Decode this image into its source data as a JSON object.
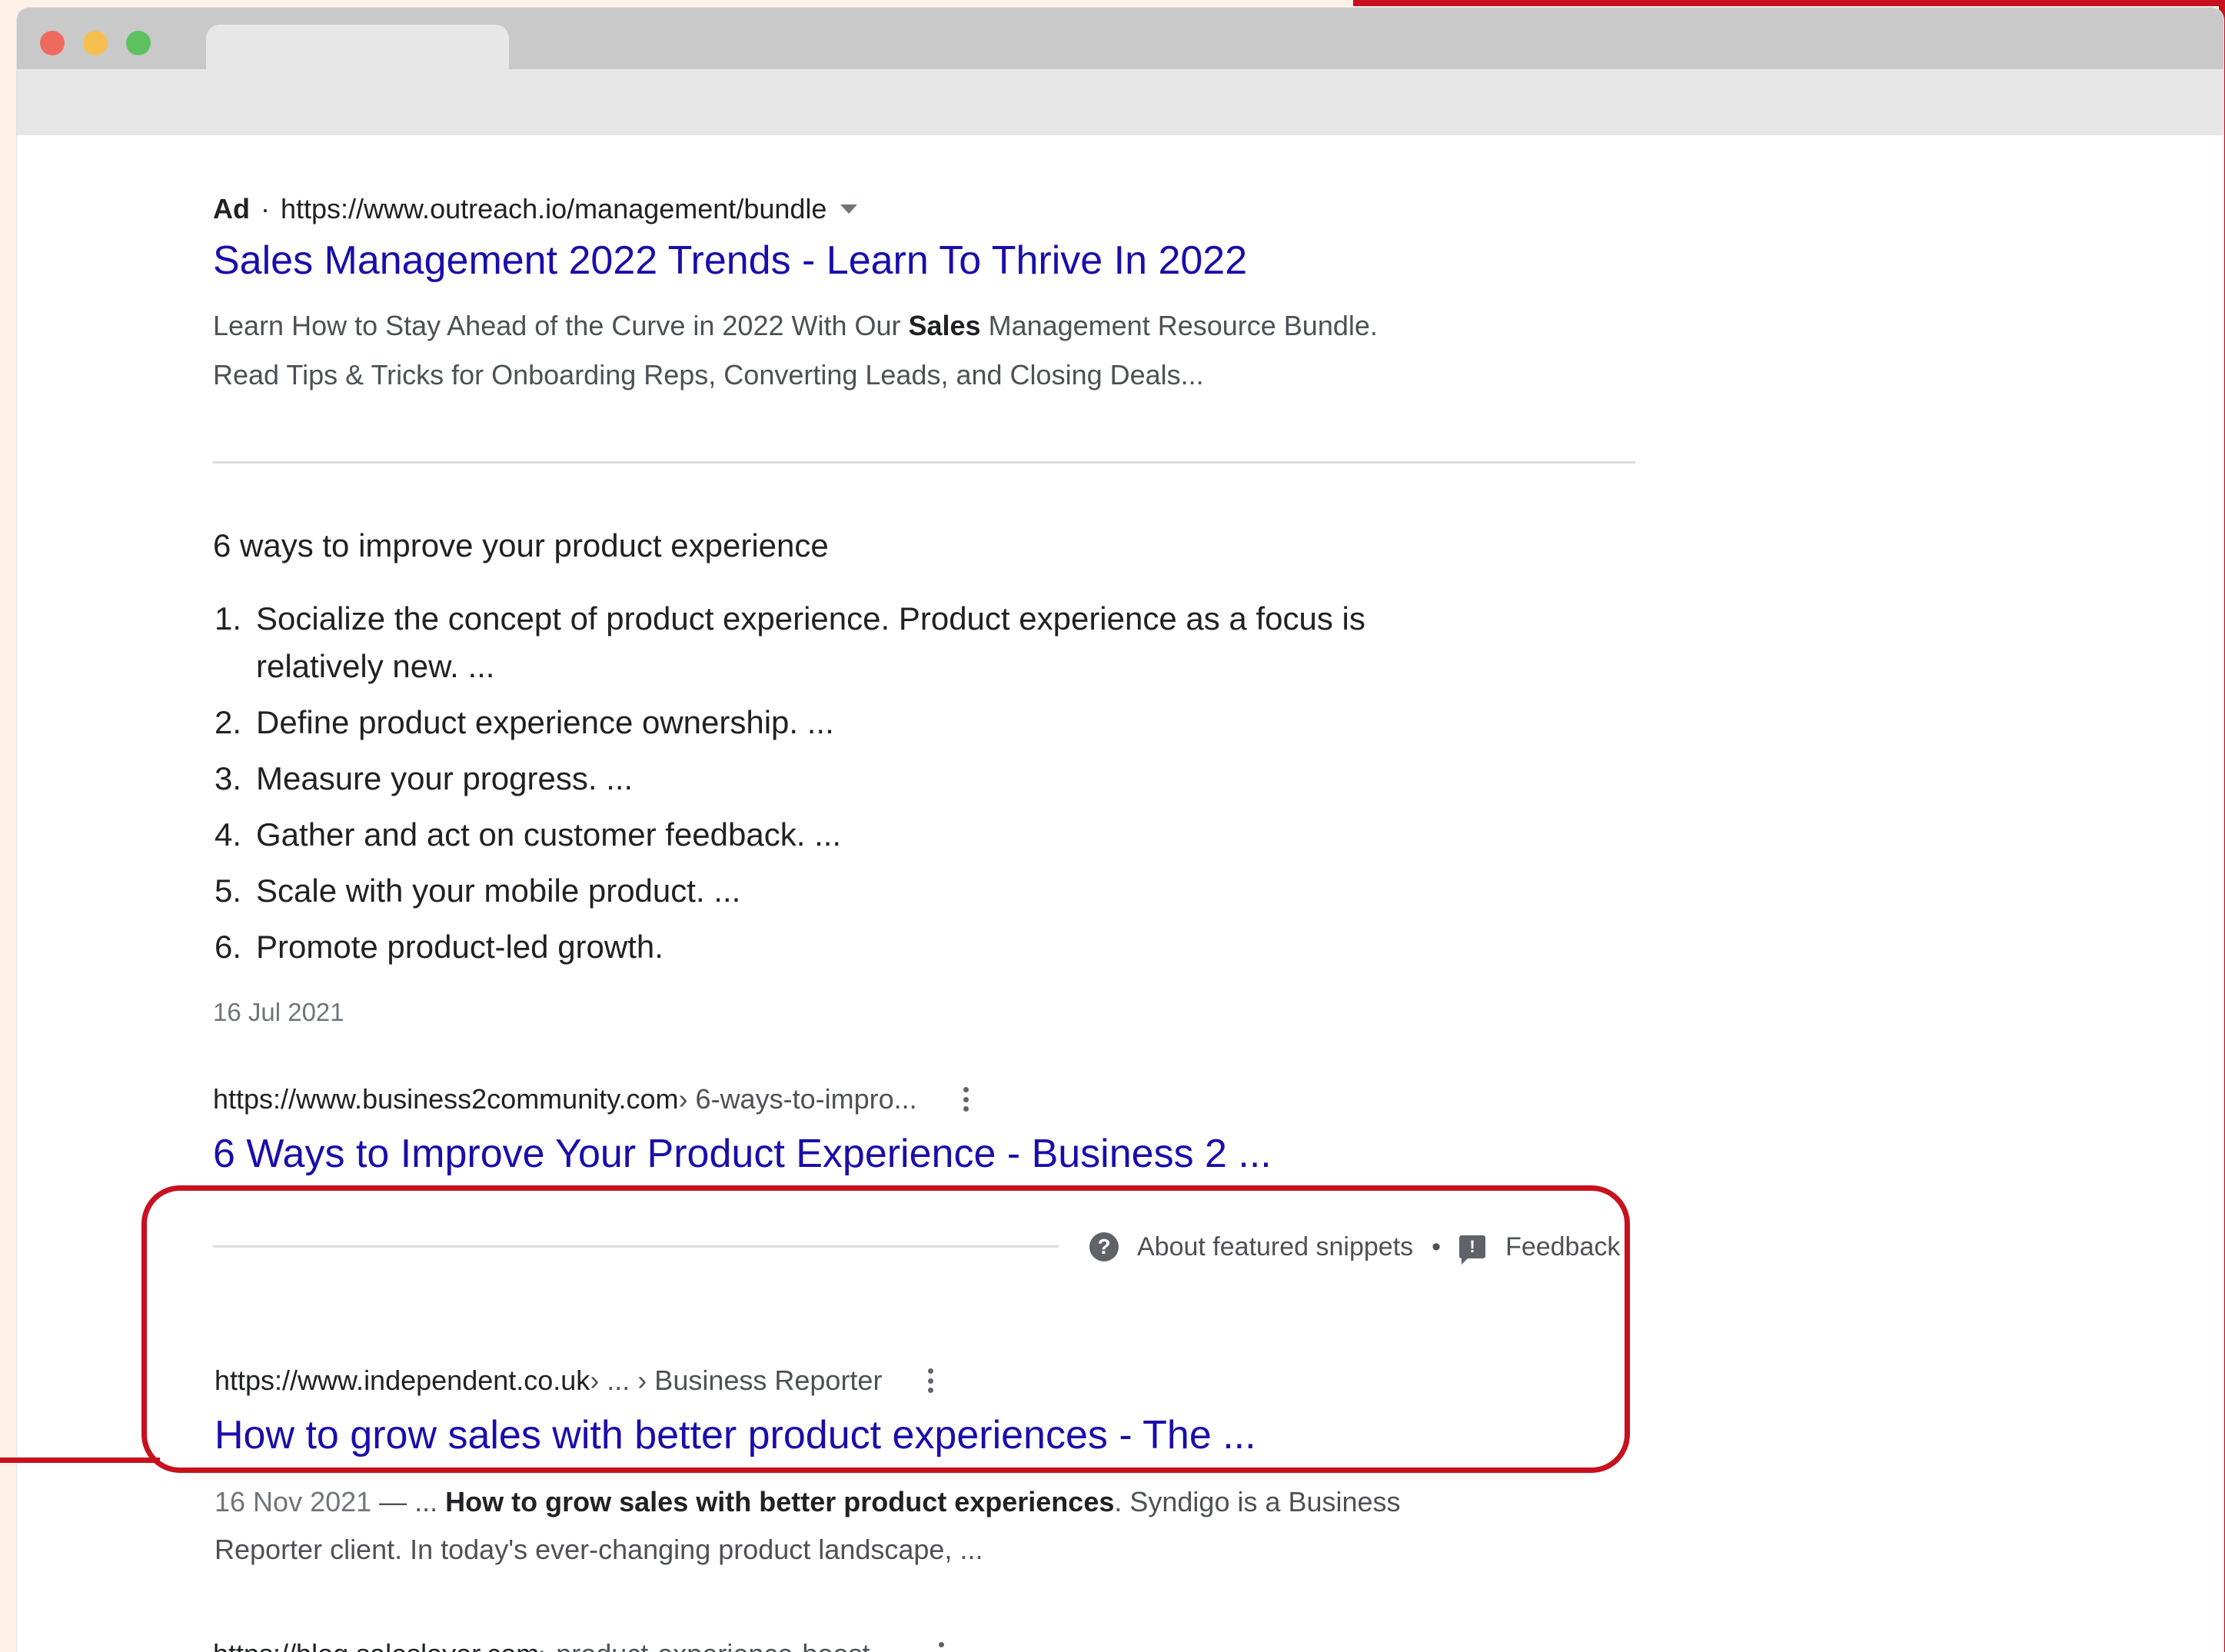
{
  "colors": {
    "highlight_border": "#c8101e",
    "link_blue": "#1a0dab",
    "text_dark": "#202124",
    "text_gray": "#4d5156",
    "page_background": "#fdf2e5"
  },
  "ad": {
    "label": "Ad",
    "separator": "·",
    "url": "https://www.outreach.io/management/bundle",
    "title": "Sales Management 2022 Trends - Learn To Thrive In 2022",
    "desc_line1_before": "Learn How to Stay Ahead of the Curve in 2022 With Our ",
    "desc_line1_bold": "Sales",
    "desc_line1_after": " Management Resource Bundle.",
    "desc_line2": "Read Tips & Tricks for Onboarding Reps, Converting Leads, and Closing Deals..."
  },
  "featured_snippet": {
    "heading": "6 ways to improve your product experience",
    "items": [
      {
        "num": "1.",
        "line1": "Socialize the concept of product experience. Product experience as a focus is",
        "line2": "relatively new. ..."
      },
      {
        "num": "2.",
        "line1": "Define product experience ownership. ..."
      },
      {
        "num": "3.",
        "line1": "Measure your progress. ..."
      },
      {
        "num": "4.",
        "line1": "Gather and act on customer feedback. ..."
      },
      {
        "num": "5.",
        "line1": "Scale with your mobile product. ..."
      },
      {
        "num": "6.",
        "line1": "Promote product-led growth."
      }
    ],
    "date": "16 Jul 2021",
    "source_domain": "https://www.business2community.com",
    "source_path": " › 6-ways-to-impro...",
    "source_title": "6 Ways to Improve Your Product Experience - Business 2 ...",
    "about_label": "About featured snippets",
    "dot": "•",
    "feedback_label": "Feedback"
  },
  "result_independent": {
    "domain": "https://www.independent.co.uk",
    "path": " › ... › Business Reporter",
    "title": "How to grow sales with better product experiences - The ...",
    "date": "16 Nov 2021",
    "dash": " — ... ",
    "bold": "How to grow sales with better product experiences",
    "after_bold": ". Syndigo is a Business",
    "line2": "Reporter client. In today's ever-changing product landscape, ..."
  },
  "result_saleslayer_partial": {
    "domain": "https://blog.saleslayer.com",
    "path": " › product-experience-boost..."
  }
}
